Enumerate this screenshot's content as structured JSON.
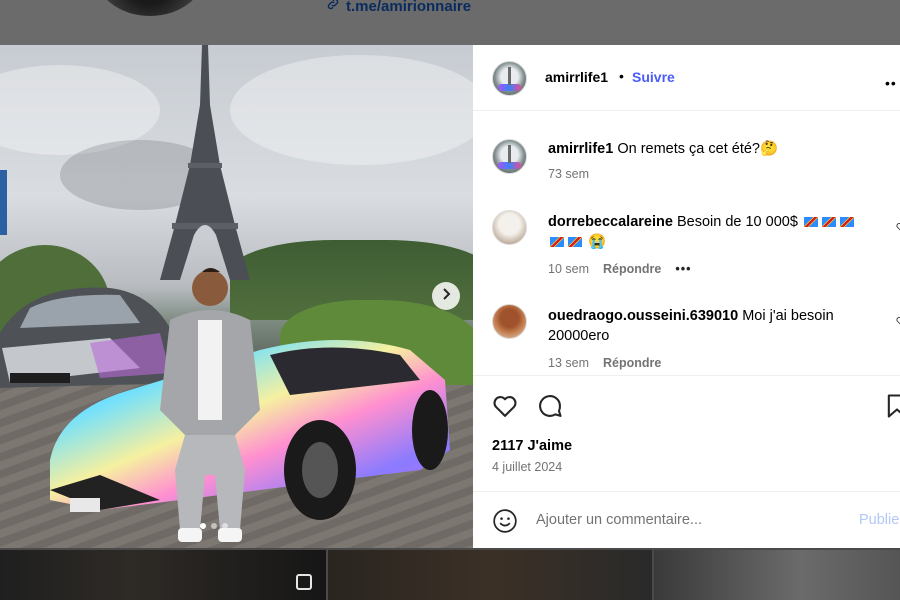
{
  "profile_bar": {
    "link_text": "t.me/amirionnaire"
  },
  "post": {
    "author": "amirrlife1",
    "separator": "•",
    "follow_label": "Suivre",
    "more_label": "••",
    "caption": {
      "username": "amirrlife1",
      "text": "On remets ça cet été?🤔",
      "time": "73 sem"
    },
    "carousel": {
      "slide_count": 3,
      "active_slide": 1
    },
    "comments": [
      {
        "username": "dorrebeccalareine",
        "text_line1": "Besoin de 10 000$",
        "text_line2_suffix": "😭",
        "flag_count_line1": 3,
        "flag_count_line2": 2,
        "time": "10 sem",
        "reply_label": "Répondre",
        "more_label": "•••"
      },
      {
        "username": "ouedraogo.ousseini.639010",
        "text": "Moi j'ai besoin 20000ero",
        "time": "13 sem",
        "reply_label": "Répondre"
      }
    ],
    "likes_text": "2117 J'aime",
    "date_text": "4 juillet 2024",
    "add_comment": {
      "placeholder": "Ajouter un commentaire...",
      "post_label": "Publier"
    }
  },
  "icons": {
    "link": "link-icon",
    "next": "chevron-right-icon",
    "like": "heart-icon",
    "comment": "comment-icon",
    "save": "bookmark-icon",
    "emoji": "emoji-icon",
    "multi": "multiple-photos-icon"
  },
  "colors": {
    "follow": "#4a5df9",
    "post_button_disabled": "#b3c8f7",
    "secondary_text": "#737373",
    "overlay": "#5a5a5a"
  }
}
